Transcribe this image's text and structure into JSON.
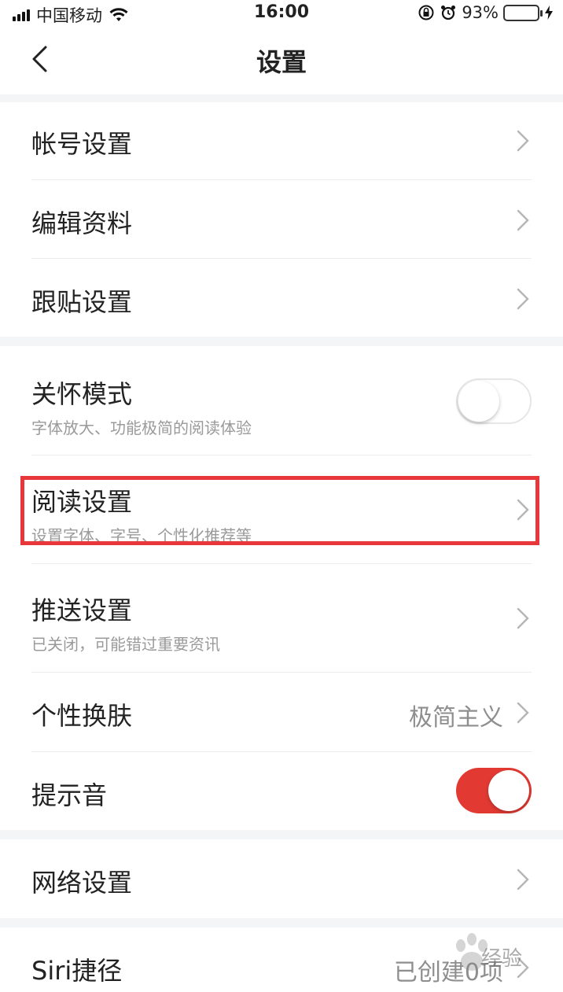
{
  "status_bar": {
    "carrier": "中国移动",
    "time": "16:00",
    "battery_percent": "93%",
    "battery_level": 0.93,
    "icons": [
      "signal-icon",
      "wifi-icon",
      "rotation-lock-icon",
      "alarm-icon",
      "battery-icon",
      "charging-icon"
    ]
  },
  "nav": {
    "title": "设置",
    "back_icon": "chevron-left-icon"
  },
  "sections": {
    "account": {
      "account_settings": "帐号设置",
      "edit_profile": "编辑资料",
      "follow_post_settings": "跟贴设置"
    },
    "display": {
      "care_mode": {
        "title": "关怀模式",
        "subtitle": "字体放大、功能极简的阅读体验",
        "enabled": false
      },
      "reading_settings": {
        "title": "阅读设置",
        "subtitle": "设置字体、字号、个性化推荐等"
      },
      "push_settings": {
        "title": "推送设置",
        "subtitle": "已关闭，可能错过重要资讯"
      },
      "skin": {
        "title": "个性换肤",
        "value": "极简主义"
      },
      "notification_sound": {
        "title": "提示音",
        "enabled": true
      }
    },
    "network": {
      "network_settings": "网络设置"
    },
    "siri": {
      "title": "Siri捷径",
      "value": "已创建0项"
    }
  },
  "watermark": {
    "text": "经验"
  },
  "colors": {
    "accent_red": "#e23a33",
    "highlight_border": "#e8373b",
    "battery_green": "#4cd964",
    "page_bg": "#f4f5f7"
  }
}
